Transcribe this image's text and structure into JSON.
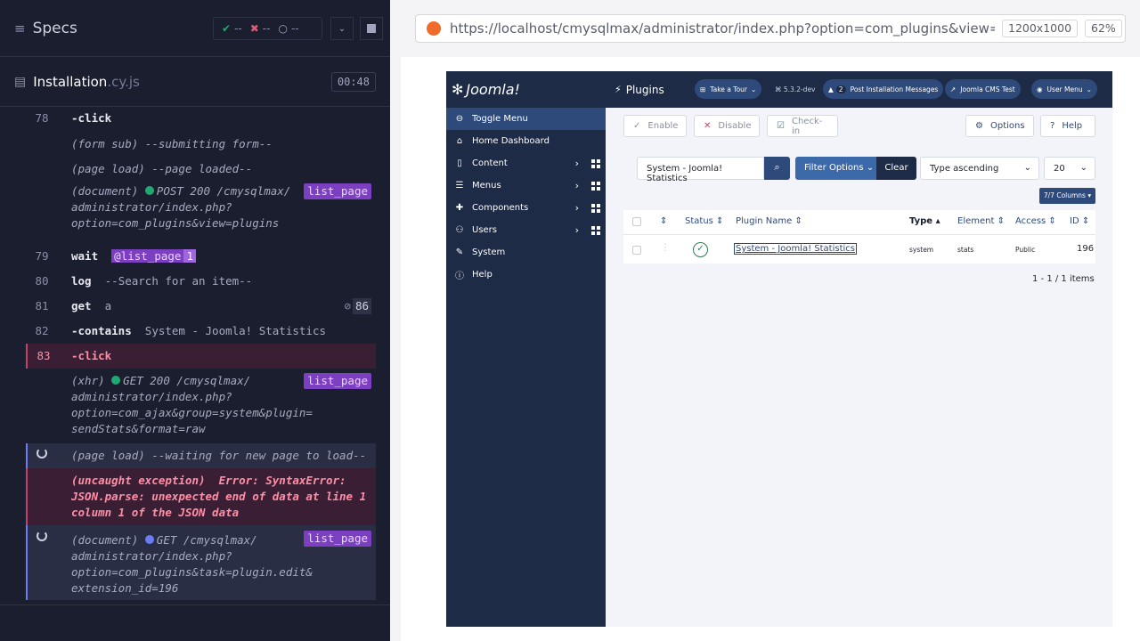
{
  "runner": {
    "specs_label": "Specs",
    "stats": {
      "passed": "--",
      "failed": "--",
      "pending": "--"
    },
    "file": {
      "name": "Installation",
      "ext": ".cy.js",
      "duration": "00:48"
    },
    "log": [
      {
        "num": "78",
        "cmd": "-click"
      },
      {
        "sub": "(form sub)",
        "msg": "--submitting form--"
      },
      {
        "sub": "(page load)",
        "msg": "--page loaded--"
      },
      {
        "sub": "(document)",
        "msg": "POST 200 /cmysqlmax/ administrator/index.php? option=com_plugins&view=plugins",
        "alias": "list_page"
      },
      {
        "num": "79",
        "cmd": "wait",
        "alias_ref": "@list_page",
        "alias_count": "1"
      },
      {
        "num": "80",
        "cmd": "log",
        "msg": "--Search for an item--"
      },
      {
        "num": "81",
        "cmd": "get",
        "arg": "a",
        "count": "86"
      },
      {
        "num": "82",
        "cmd": "-contains",
        "arg": "System - Joomla! Statistics"
      },
      {
        "num": "83",
        "cmd": "-click"
      },
      {
        "sub": "(xhr)",
        "msg": "GET 200 /cmysqlmax/ administrator/index.php? option=com_ajax&group=system&plugin= sendStats&format=raw",
        "alias": "list_page"
      },
      {
        "sub": "(page load)",
        "msg": "--waiting for new page to load--"
      },
      {
        "sub": "(uncaught exception)",
        "msg": "Error: SyntaxError: JSON.parse: unexpected end of data at line 1 column 1 of the JSON data"
      },
      {
        "sub": "(document)",
        "msg": "GET /cmysqlmax/ administrator/index.php? option=com_plugins&task=plugin.edit& extension_id=196",
        "alias": "list_page"
      }
    ]
  },
  "browser": {
    "url": "https://localhost/cmysqlmax/administrator/index.php?option=com_plugins&view=plugi",
    "viewport": "1200x1000",
    "zoom": "62%"
  },
  "joomla": {
    "logo": "Joomla!",
    "menu": [
      "Toggle Menu",
      "Home Dashboard",
      "Content",
      "Menus",
      "Components",
      "Users",
      "System",
      "Help"
    ],
    "page_title": "Plugins",
    "top": {
      "tour": "Take a Tour",
      "version": "5.3.2-dev",
      "notif_count": "2",
      "post_install": "Post Installation Messages",
      "site": "Joomla CMS Test",
      "user": "User Menu"
    },
    "toolbar": {
      "enable": "Enable",
      "disable": "Disable",
      "checkin": "Check-in",
      "options": "Options",
      "help": "Help"
    },
    "search": {
      "value": "System - Joomla! Statistics",
      "filter": "Filter Options",
      "clear": "Clear",
      "sort": "Type ascending",
      "limit": "20",
      "columns": "7/7 Columns"
    },
    "table": {
      "headers": [
        "Status",
        "Plugin Name",
        "Type",
        "Element",
        "Access",
        "ID"
      ],
      "rows": [
        {
          "name": "System - Joomla! Statistics",
          "type": "system",
          "element": "stats",
          "access": "Public",
          "id": "196"
        }
      ]
    },
    "pagination": "1 - 1 / 1 items"
  }
}
